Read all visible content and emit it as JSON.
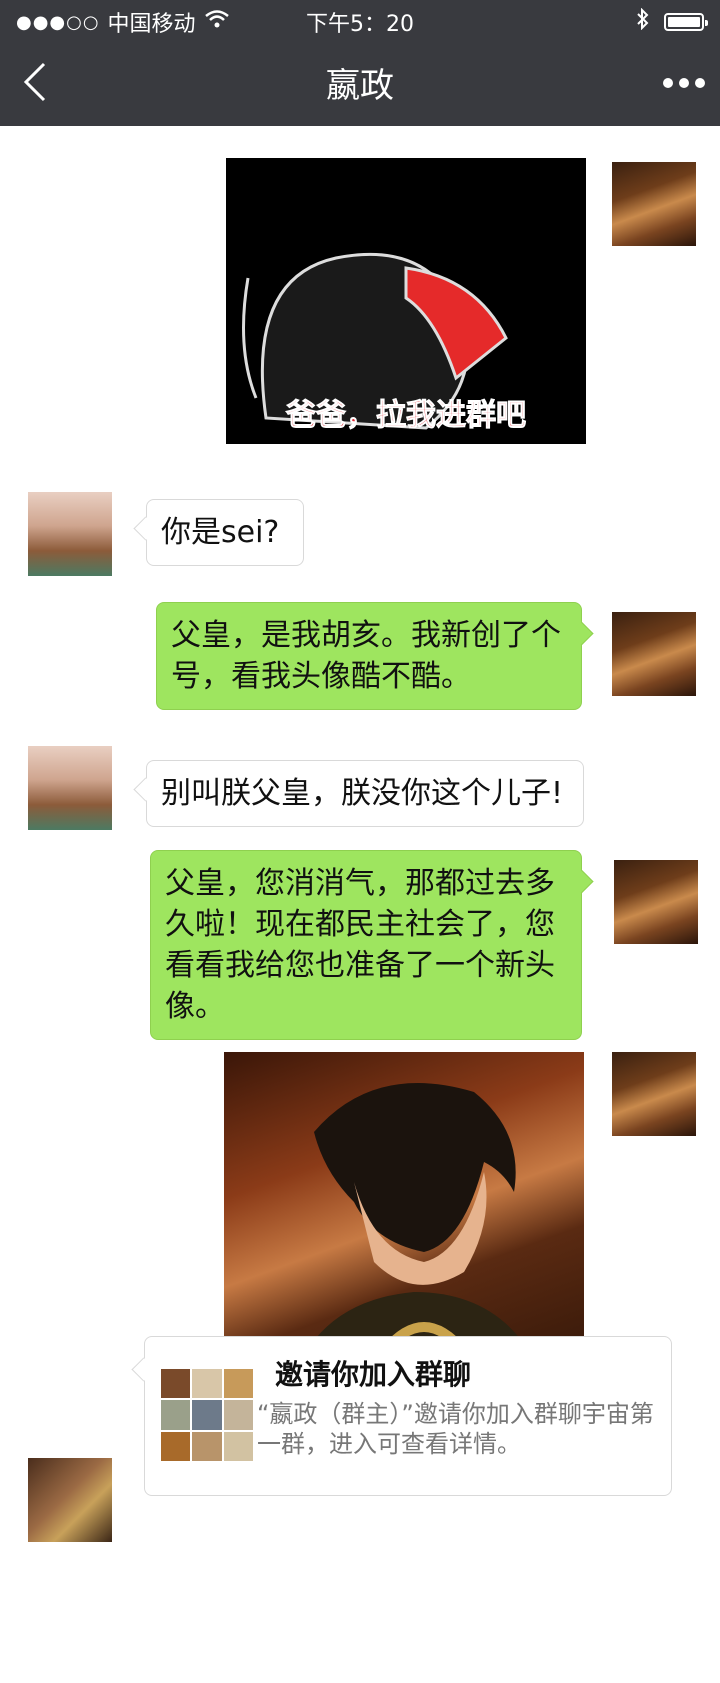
{
  "status_bar": {
    "carrier": "中国移动",
    "time": "下午5：20"
  },
  "nav": {
    "title": "嬴政"
  },
  "messages": {
    "image1_caption": "爸爸，拉我进群吧",
    "m1": "你是sei?",
    "m2": "父皇，是我胡亥。我新创了个号，看我头像酷不酷。",
    "m3": "别叫朕父皇，朕没你这个儿子!",
    "m4": "父皇，您消消气，那都过去多久啦！现在都民主社会了，您看看我给您也准备了一个新头像。"
  },
  "invite": {
    "title": "邀请你加入群聊",
    "desc": "“嬴政（群主）”邀请你加入群聊宇宙第一群，进入可查看详情。"
  },
  "colors": {
    "nav_bg": "#393a3f",
    "out_bubble": "#9ee55f",
    "in_bubble": "#ffffff"
  }
}
